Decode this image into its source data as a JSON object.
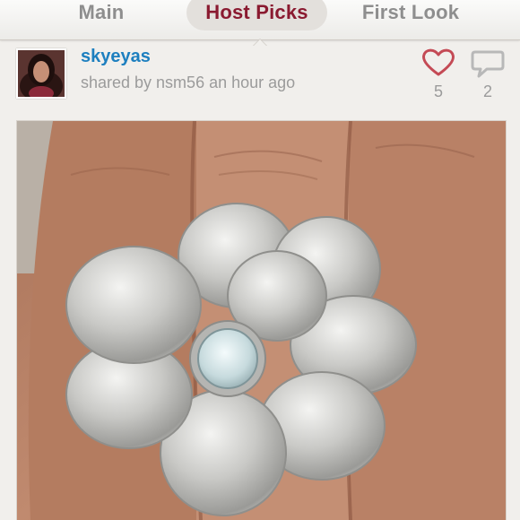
{
  "tabs": [
    {
      "label": "Main",
      "active": false
    },
    {
      "label": "Host Picks",
      "active": true
    },
    {
      "label": "First Look",
      "active": false
    }
  ],
  "post": {
    "username": "skyeyas",
    "shared_by_text": "shared by nsm56 an hour ago",
    "likes": "5",
    "comments": "2"
  },
  "icons": {
    "like": "heart-outline-icon",
    "comment": "speech-bubble-icon"
  },
  "colors": {
    "active_tab": "#8a1a30",
    "username": "#1d7fbf",
    "heart": "#c44a55",
    "muted_text": "#9b9b9b",
    "background": "#f1efec"
  }
}
